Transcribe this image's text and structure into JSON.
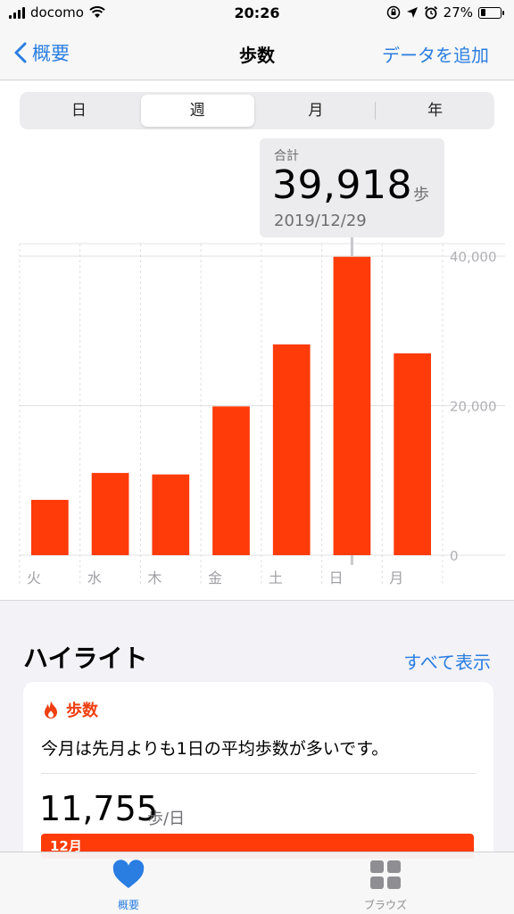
{
  "status_bar": {
    "carrier": "docomo",
    "time": "20:26",
    "battery": "27%",
    "battery_level": 0.27,
    "icons": [
      "signal-bars-icon",
      "wifi-icon",
      "orientation-lock-icon",
      "location-arrow-icon",
      "alarm-icon",
      "battery-icon"
    ]
  },
  "nav": {
    "back_label": "概要",
    "title": "歩数",
    "action_label": "データを追加"
  },
  "segments": [
    {
      "label": "日",
      "selected": false
    },
    {
      "label": "週",
      "selected": true
    },
    {
      "label": "月",
      "selected": false
    },
    {
      "label": "年",
      "selected": false
    }
  ],
  "callout": {
    "label": "合計",
    "value": "39,918",
    "unit": "歩",
    "date": "2019/12/29"
  },
  "chart_data": {
    "type": "bar",
    "categories": [
      "火",
      "水",
      "木",
      "金",
      "土",
      "日",
      "月"
    ],
    "values": [
      7400,
      11000,
      10800,
      19900,
      28200,
      39918,
      27000
    ],
    "ylim": [
      0,
      40000
    ],
    "yticks": [
      "40,000",
      "20,000",
      "0"
    ],
    "ytick_values": [
      40000,
      20000,
      0
    ],
    "selected_index": 5,
    "bar_color": "#ff3b0a",
    "grid": true
  },
  "highlights": {
    "title": "ハイライト",
    "see_all_label": "すべて表示",
    "card": {
      "category": "歩数",
      "category_icon": "flame-icon",
      "text": "今月は先月よりも1日の平均歩数が多いです。",
      "number": "11,755",
      "unit": "歩/日",
      "bar_label": "12月"
    }
  },
  "tab_bar": {
    "items": [
      {
        "label": "概要",
        "icon": "heart-icon",
        "active": true
      },
      {
        "label": "ブラウズ",
        "icon": "grid-icon",
        "active": false
      }
    ]
  },
  "colors": {
    "accent": "#2a7de1",
    "bar": "#ff3b0a",
    "highlight_red": "#ee3f10"
  }
}
